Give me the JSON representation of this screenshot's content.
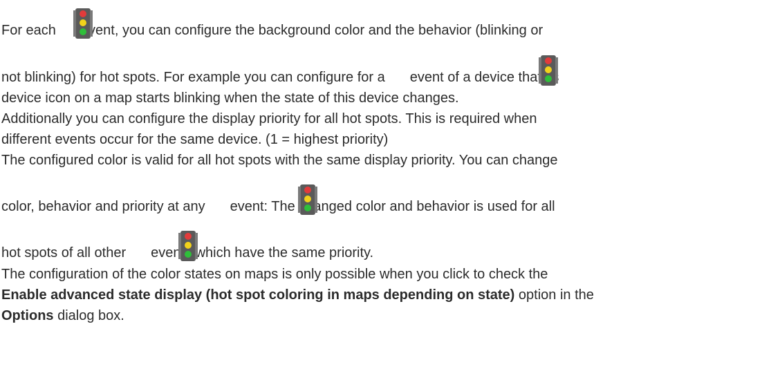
{
  "paragraph1": {
    "l1a": "For each",
    "l1b": "event, you can configure the background color and the behavior (blinking or",
    "l2a": "not blinking) for hot spots. For example you can configure for a",
    "l2b": "event of a device that its",
    "l3": "device icon on a map starts blinking when the state of this device changes."
  },
  "paragraph2": {
    "l1": "Additionally you can configure the display priority for all hot spots. This is required when",
    "l2": "different events occur for the same device. (1 = highest priority)"
  },
  "paragraph3": {
    "l1": "The configured color is valid for all hot spots with the same display priority. You can change",
    "l2a": "color, behavior and priority at any",
    "l2b": "event: The changed color and behavior is used for all",
    "l3a": "hot spots of all other",
    "l3b": "events which have the same priority."
  },
  "paragraph4": {
    "l1": "The configuration of the color states on maps is only possible when you click to check the",
    "l2_bold": "Enable advanced state display (hot spot coloring in maps depending on state)",
    "l2_rest": " option in the",
    "l3_bold": "Options",
    "l3_rest": " dialog box."
  },
  "icons": {
    "traffic_light": "traffic-light-icon"
  }
}
